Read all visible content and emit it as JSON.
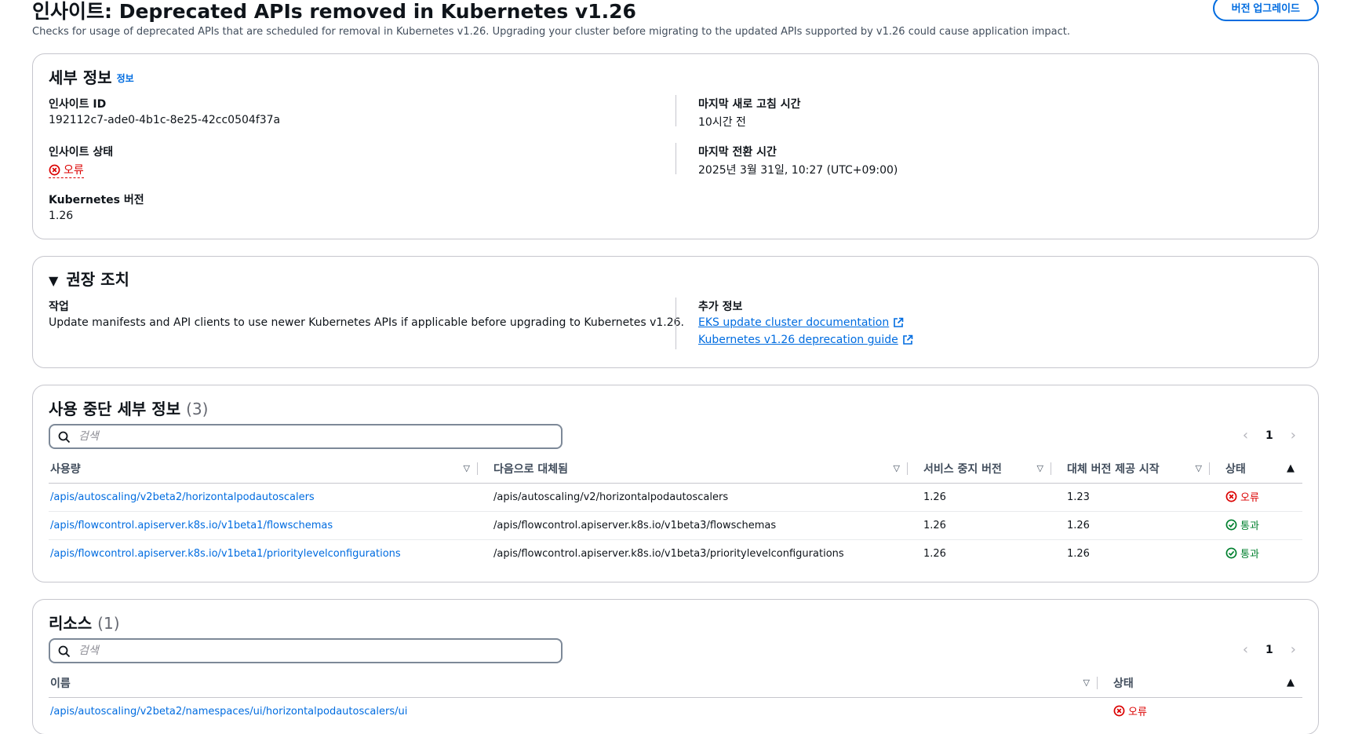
{
  "header": {
    "title": "인사이트: Deprecated APIs removed in Kubernetes v1.26",
    "description": "Checks for usage of deprecated APIs that are scheduled for removal in Kubernetes v1.26. Upgrading your cluster before migrating to the updated APIs supported by v1.26 could cause application impact.",
    "upgrade_button": "버전 업그레이드"
  },
  "details": {
    "title": "세부 정보",
    "info_link": "정보",
    "insight_id_label": "인사이트 ID",
    "insight_id": "192112c7-ade0-4b1c-8e25-42cc0504f37a",
    "insight_status_label": "인사이트 상태",
    "insight_status": "오류",
    "k8s_version_label": "Kubernetes 버전",
    "k8s_version": "1.26",
    "last_refresh_label": "마지막 새로 고침 시간",
    "last_refresh": "10시간 전",
    "last_transition_label": "마지막 전환 시간",
    "last_transition": "2025년 3월 31일, 10:27 (UTC+09:00)"
  },
  "recommendation": {
    "title": "권장 조치",
    "task_label": "작업",
    "task": "Update manifests and API clients to use newer Kubernetes APIs if applicable before upgrading to Kubernetes v1.26.",
    "more_info_label": "추가 정보",
    "link1": "EKS update cluster documentation",
    "link2": "Kubernetes v1.26 deprecation guide"
  },
  "deprecations": {
    "title": "사용 중단 세부 정보",
    "count": "(3)",
    "search_placeholder": "검색",
    "page": "1",
    "columns": [
      "사용량",
      "다음으로 대체됨",
      "서비스 중지 버전",
      "대체 버전 제공 시작",
      "상태"
    ],
    "rows": [
      {
        "usage": "/apis/autoscaling/v2beta2/horizontalpodautoscalers",
        "replaced_by": "/apis/autoscaling/v2/horizontalpodautoscalers",
        "stop_version": "1.26",
        "start_version": "1.23",
        "status": "오류"
      },
      {
        "usage": "/apis/flowcontrol.apiserver.k8s.io/v1beta1/flowschemas",
        "replaced_by": "/apis/flowcontrol.apiserver.k8s.io/v1beta3/flowschemas",
        "stop_version": "1.26",
        "start_version": "1.26",
        "status": "통과"
      },
      {
        "usage": "/apis/flowcontrol.apiserver.k8s.io/v1beta1/prioritylevelconfigurations",
        "replaced_by": "/apis/flowcontrol.apiserver.k8s.io/v1beta3/prioritylevelconfigurations",
        "stop_version": "1.26",
        "start_version": "1.26",
        "status": "통과"
      }
    ]
  },
  "resources": {
    "title": "리소스",
    "count": "(1)",
    "search_placeholder": "검색",
    "page": "1",
    "columns": [
      "이름",
      "상태"
    ],
    "rows": [
      {
        "name": "/apis/autoscaling/v2beta2/namespaces/ui/horizontalpodautoscalers/ui",
        "status": "오류"
      }
    ]
  },
  "colors": {
    "link": "#006ce0",
    "error": "#db0000",
    "success": "#00802f",
    "border": "#c6c6cd"
  }
}
